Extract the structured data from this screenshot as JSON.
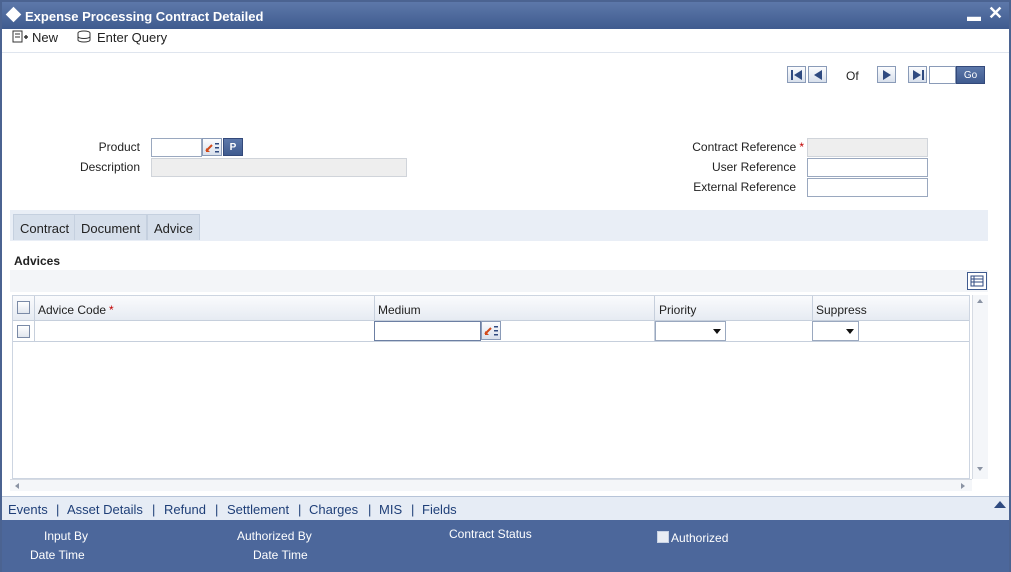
{
  "window": {
    "title": "Expense Processing Contract Detailed"
  },
  "toolbar": {
    "new_label": "New",
    "enter_query_label": "Enter Query"
  },
  "pagination": {
    "of_label": "Of",
    "page_value": "",
    "go_label": "Go"
  },
  "header": {
    "product_label": "Product",
    "product_value": "",
    "p_button_label": "P",
    "description_label": "Description",
    "description_value": "",
    "contract_reference_label": "Contract Reference",
    "contract_reference_value": "",
    "user_reference_label": "User Reference",
    "user_reference_value": "",
    "external_reference_label": "External Reference",
    "external_reference_value": ""
  },
  "tabs": [
    {
      "label": "Contract"
    },
    {
      "label": "Document"
    },
    {
      "label": "Advice"
    }
  ],
  "advices": {
    "section_title": "Advices",
    "columns": [
      "Advice Code",
      "Medium",
      "Priority",
      "Suppress"
    ],
    "rows": [
      {
        "advice_code": "",
        "medium": "",
        "priority": "",
        "suppress": ""
      }
    ]
  },
  "links": [
    "Events",
    "Asset Details",
    "Refund",
    "Settlement",
    "Charges",
    "MIS",
    "Fields"
  ],
  "footer": {
    "input_by_label": "Input By",
    "date_time_label_1": "Date Time",
    "authorized_by_label": "Authorized By",
    "date_time_label_2": "Date Time",
    "contract_status_label": "Contract Status",
    "authorized_label": "Authorized"
  },
  "colors": {
    "title_bar": "#4c679b",
    "required_marker": "#c00000",
    "link_text": "#1f3f78"
  }
}
